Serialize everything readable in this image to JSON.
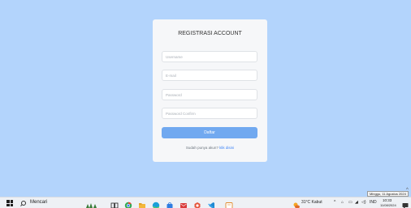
{
  "form": {
    "title": "REGISTRASI ACCOUNT",
    "username_placeholder": "Username",
    "email_placeholder": "E-mail",
    "password_placeholder": "Password",
    "password_confirm_placeholder": "Password Confirm",
    "submit_label": "Daftar",
    "login_prompt": "Sudah punya akun?",
    "login_link": "klik disini"
  },
  "taskbar": {
    "search_label": "Mencari",
    "weather": "31°C Kabut",
    "language": "IND",
    "time": "10:33",
    "date": "11/08/2024",
    "apps": [
      "widgets-icon",
      "task-view-icon",
      "chrome-icon",
      "file-explorer-icon",
      "edge-icon",
      "store-icon",
      "mail-icon",
      "office-icon",
      "vscode-icon",
      "notes-icon"
    ]
  },
  "tooltip": {
    "text": "Minggu, 11 Agustus 2024"
  },
  "colors": {
    "background": "#b3d4fc",
    "card": "#f6f7f9",
    "button": "#71a9f0",
    "link": "#3b82f6"
  }
}
